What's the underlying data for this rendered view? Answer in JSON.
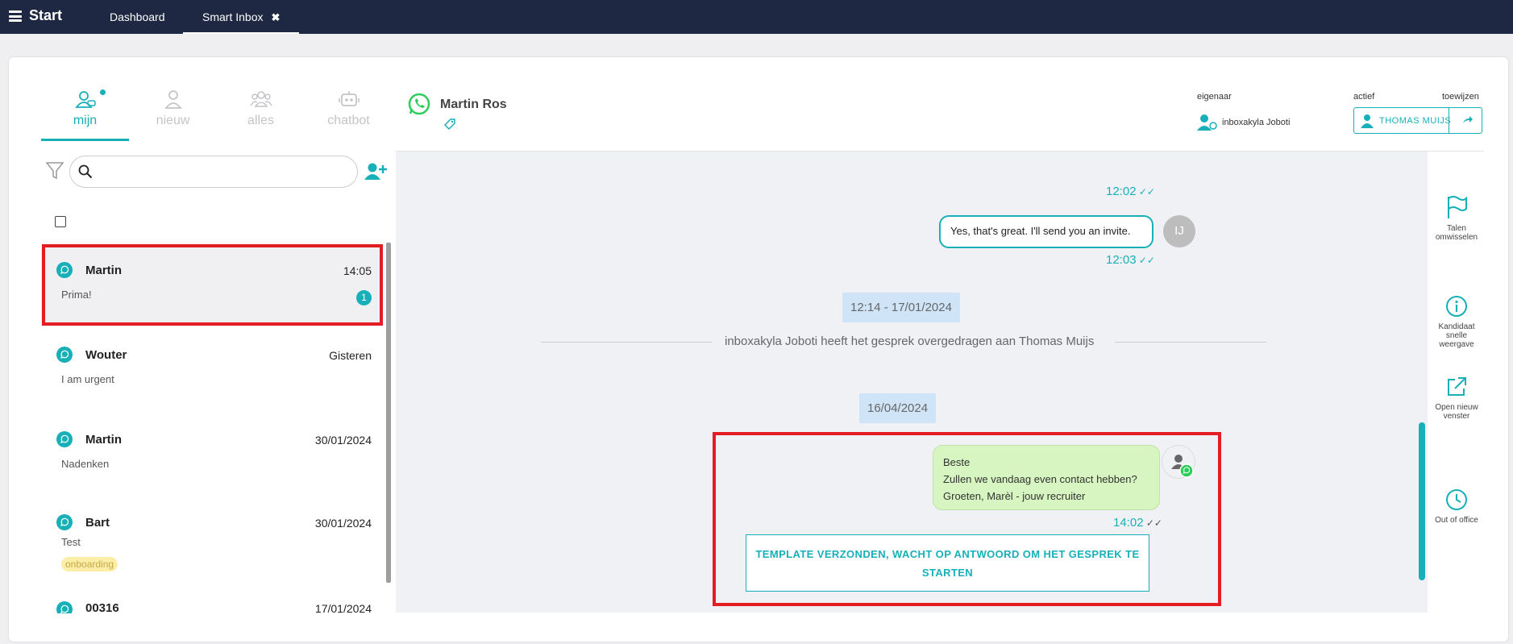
{
  "topbar": {
    "brand": "Start",
    "tabs": [
      {
        "label": "Dashboard"
      },
      {
        "label": "Smart Inbox",
        "close": "✖"
      }
    ]
  },
  "filters": {
    "tabs": [
      {
        "label": "mijn",
        "active": true
      },
      {
        "label": "nieuw"
      },
      {
        "label": "alles"
      },
      {
        "label": "chatbot"
      }
    ]
  },
  "search": {
    "value": "",
    "placeholder": ""
  },
  "conversations": [
    {
      "name": "Martin",
      "time": "14:05",
      "preview": "Prima!",
      "unread": "1"
    },
    {
      "name": "Wouter",
      "time": "Gisteren",
      "preview": "I am urgent"
    },
    {
      "name": "Martin",
      "time": "30/01/2024",
      "preview": "Nadenken"
    },
    {
      "name": "Bart",
      "time": "30/01/2024",
      "preview": "Test",
      "tag": "onboarding"
    },
    {
      "name": "00316",
      "time": "17/01/2024",
      "preview": ""
    }
  ],
  "header": {
    "contact_name": "Martin Ros",
    "owner_label": "eigenaar",
    "owner_name": "inboxakyla Joboti",
    "active_label": "actief",
    "assign_label": "toewijzen",
    "assignee": "THOMAS MUIJS"
  },
  "chat": {
    "time1": "12:02",
    "msg1": "Yes, that's great. I'll send you an invite.",
    "avatar1": "IJ",
    "time2": "12:03",
    "date1": "12:14 - 17/01/2024",
    "system_msg": "inboxakyla Joboti heeft het gesprek overgedragen aan Thomas Muijs",
    "date2": "16/04/2024",
    "template_lines": [
      "Beste",
      "Zullen we vandaag even contact hebben?",
      "Groeten, Marèl - jouw recruiter"
    ],
    "time3": "14:02",
    "template_notice": "TEMPLATE VERZONDEN, WACHT OP ANTWOORD OM HET GESPREK TE STARTEN"
  },
  "actions": [
    {
      "label": "Talen omwisselen",
      "icon": "flag-icon"
    },
    {
      "label": "Kandidaat snelle weergave",
      "icon": "info-icon"
    },
    {
      "label": "Open nieuw venster",
      "icon": "external-link-icon"
    },
    {
      "label": "Out of office",
      "icon": "clock-icon"
    }
  ],
  "colors": {
    "accent": "#17b0b8",
    "topbar": "#1f2843",
    "highlight": "#e41c23"
  }
}
